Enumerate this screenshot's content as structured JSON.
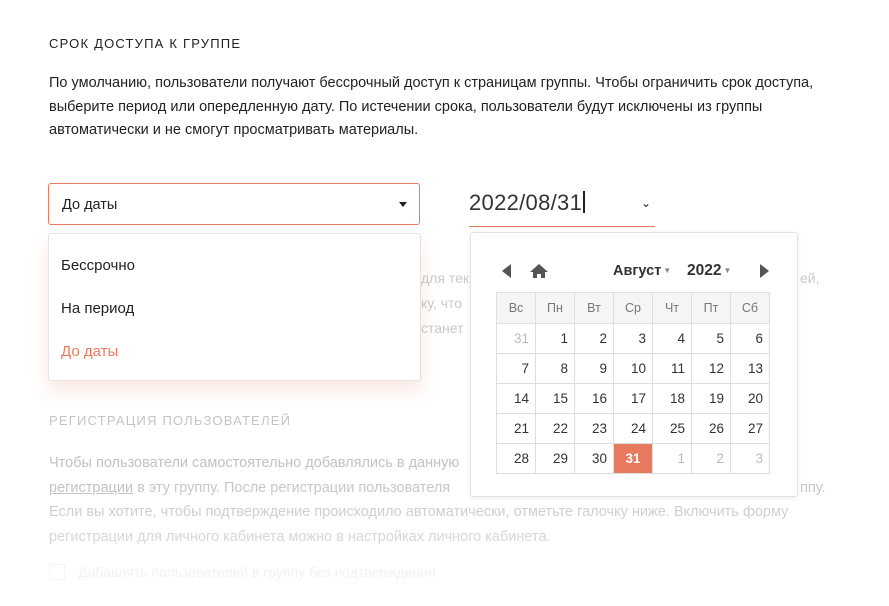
{
  "section_title": "СРОК ДОСТУПА К ГРУППЕ",
  "description": "По умолчанию, пользователи получают бессрочный доступ к страницам группы. Чтобы ограничить срок доступа, выберите период или опередленную дату. По истечении срока, пользователи будут исключены из группы автоматически и не смогут просматривать материалы.",
  "access_select": {
    "value": "До даты",
    "options": [
      "Бессрочно",
      "На период",
      "До даты"
    ]
  },
  "date_input": {
    "value": "2022/08/31"
  },
  "calendar": {
    "month": "Август",
    "year": "2022",
    "weekdays": [
      "Вс",
      "Пн",
      "Вт",
      "Ср",
      "Чт",
      "Пт",
      "Сб"
    ],
    "weeks": [
      [
        "31",
        "1",
        "2",
        "3",
        "4",
        "5",
        "6"
      ],
      [
        "7",
        "8",
        "9",
        "10",
        "11",
        "12",
        "13"
      ],
      [
        "14",
        "15",
        "16",
        "17",
        "18",
        "19",
        "20"
      ],
      [
        "21",
        "22",
        "23",
        "24",
        "25",
        "26",
        "27"
      ],
      [
        "28",
        "29",
        "30",
        "31",
        "1",
        "2",
        "3"
      ]
    ],
    "selected_day": "31",
    "accent_color": "#e87a60"
  },
  "background": {
    "fragment_1": "для тек",
    "fragment_2": "ку, что",
    "fragment_3": "станет",
    "fragment_right": "ей,",
    "registration_title": "РЕГИСТРАЦИЯ ПОЛЬЗОВАТЕЛЕЙ",
    "registration_text_1": "Чтобы пользователи самостоятельно добавлялись в данную",
    "registration_link": "регистрации",
    "registration_text_2": " в эту группу. После регистрации пользователя",
    "registration_text_2_end": "ппу.",
    "registration_text_3": "Если вы хотите, чтобы подтверждение происходило автоматически, отметьте галочку ниже. Включить форму",
    "registration_text_4": "регистрации для личного кабинета можно в настройках личного кабинета.",
    "checkbox_label": "Добавлять пользователей в группу без подтверждения"
  }
}
